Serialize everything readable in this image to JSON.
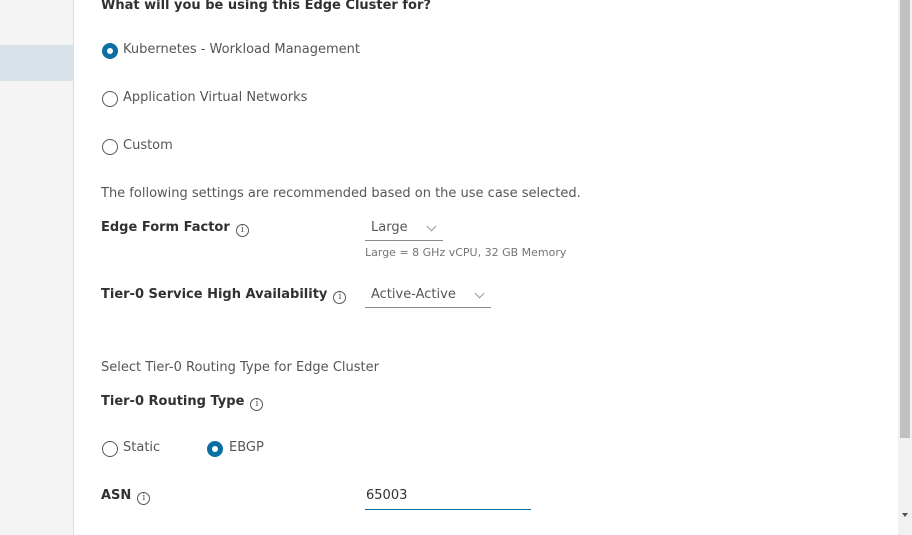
{
  "question": "What will you be using this Edge Cluster for?",
  "use_case": {
    "options": [
      {
        "label": "Kubernetes - Workload Management",
        "selected": true
      },
      {
        "label": "Application Virtual Networks",
        "selected": false
      },
      {
        "label": "Custom",
        "selected": false
      }
    ]
  },
  "recommend_text": "The following settings are recommended based on the use case selected.",
  "edge_form_factor": {
    "label": "Edge Form Factor",
    "value": "Large",
    "helper": "Large = 8 GHz vCPU, 32 GB Memory"
  },
  "tier0_ha": {
    "label": "Tier-0 Service High Availability",
    "value": "Active-Active"
  },
  "routing_section_text": "Select Tier-0 Routing Type for Edge Cluster",
  "routing_type": {
    "label": "Tier-0 Routing Type",
    "options": [
      {
        "label": "Static",
        "selected": false
      },
      {
        "label": "EBGP",
        "selected": true
      }
    ]
  },
  "asn": {
    "label": "ASN",
    "value": "65003"
  },
  "colors": {
    "accent": "#0b6fa4",
    "nav_active": "#d8e3e9"
  }
}
